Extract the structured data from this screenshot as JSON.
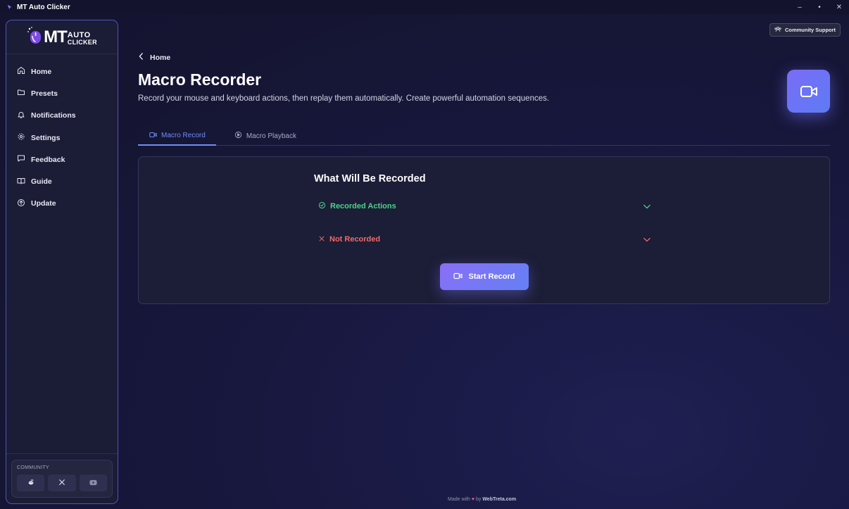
{
  "app": {
    "title": "MT Auto Clicker"
  },
  "window": {
    "minimize": "–",
    "maximize": "•",
    "close": "✕"
  },
  "logo": {
    "mt": "MT",
    "auto": "AUTO",
    "clicker": "CLICKER"
  },
  "sidebar": {
    "items": [
      {
        "label": "Home",
        "icon": "home-icon"
      },
      {
        "label": "Presets",
        "icon": "folder-icon"
      },
      {
        "label": "Notifications",
        "icon": "bell-icon"
      },
      {
        "label": "Settings",
        "icon": "gear-icon"
      },
      {
        "label": "Feedback",
        "icon": "message-icon"
      },
      {
        "label": "Guide",
        "icon": "book-icon"
      },
      {
        "label": "Update",
        "icon": "update-icon"
      }
    ],
    "community": {
      "label": "COMMUNITY",
      "links": [
        "reddit-icon",
        "x-icon",
        "youtube-icon"
      ]
    }
  },
  "header": {
    "support_label": "Community Support"
  },
  "breadcrumb": {
    "label": "Home"
  },
  "page": {
    "title": "Macro Recorder",
    "description": "Record your mouse and keyboard actions, then replay them automatically. Create powerful automation sequences."
  },
  "tabs": [
    {
      "label": "Macro Record",
      "active": true
    },
    {
      "label": "Macro Playback",
      "active": false
    }
  ],
  "card": {
    "title": "What Will Be Recorded",
    "recorded_label": "Recorded Actions",
    "not_recorded_label": "Not Recorded",
    "start_label": "Start Record"
  },
  "footer": {
    "made_with": "Made with",
    "by": "by",
    "brand": "WebTreta.com"
  },
  "colors": {
    "accent": "#6f8ff6",
    "primary_gradient_start": "#8a6ef6",
    "primary_gradient_end": "#6480f4",
    "success": "#4ad488",
    "danger": "#f06a6a",
    "sidebar_border": "#4e55b8"
  }
}
